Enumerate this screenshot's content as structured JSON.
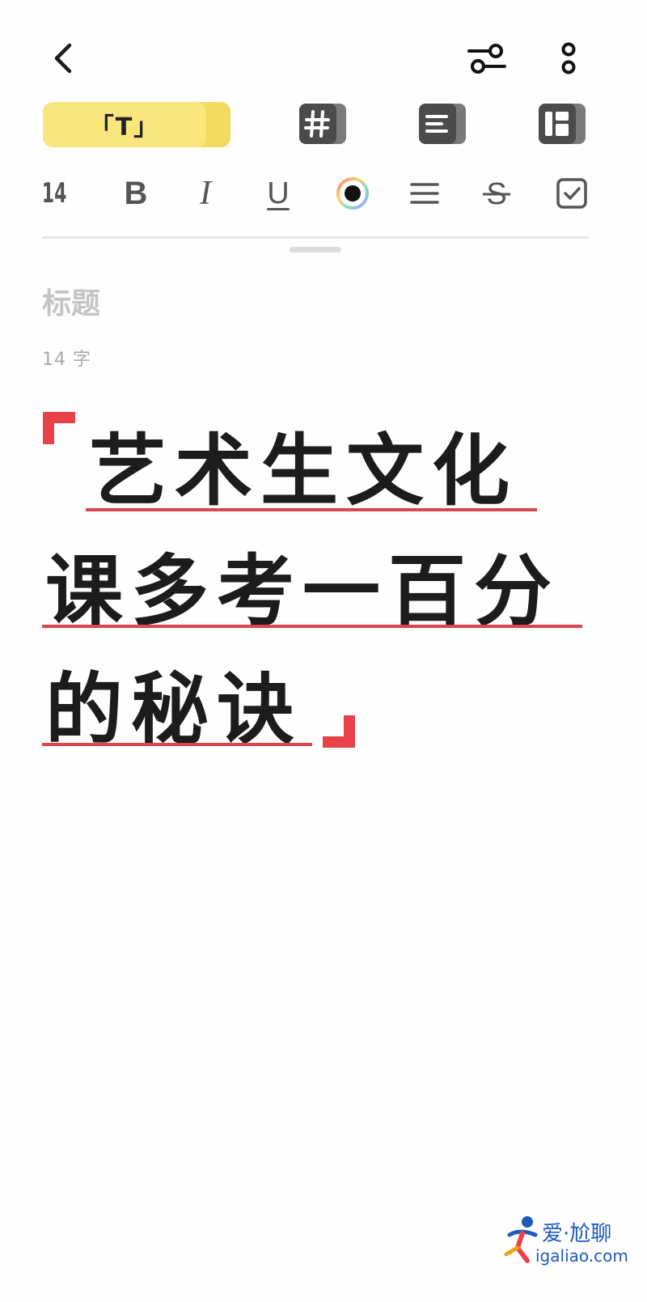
{
  "toolbar": {
    "back_icon": "chevron-left-icon",
    "settings_icon": "sliders-icon",
    "more_icon": "more-vertical-icon"
  },
  "block_styles": {
    "text_chip_label": "「T」",
    "hash_icon": "hash-block-icon",
    "list_icon": "list-block-icon",
    "layout_icon": "layout-block-icon"
  },
  "format": {
    "font_size": "14",
    "bold": "B",
    "italic": "I",
    "underline": "U",
    "strike": "S"
  },
  "note": {
    "title_placeholder": "标题",
    "word_count": "14 字",
    "body_lines": [
      "艺术生文化",
      "课多考一百分",
      "的秘诀"
    ]
  },
  "colors": {
    "accent_yellow": "#f9e67c",
    "bracket_red": "#e8414a",
    "underline_red": "#d8474b"
  },
  "watermark": {
    "brand": "爱·尬聊",
    "domain": "igaliao.com"
  }
}
